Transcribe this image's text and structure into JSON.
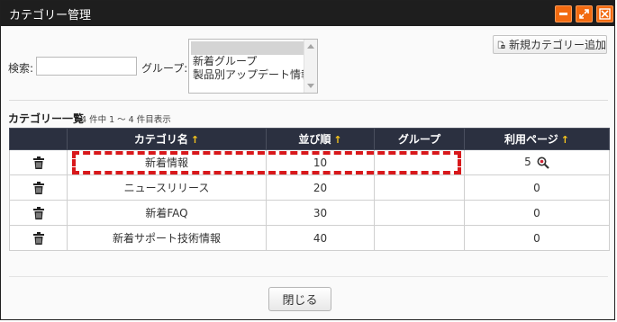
{
  "window": {
    "title": "カテゴリー管理"
  },
  "search": {
    "label": "検索:",
    "value": "",
    "placeholder": ""
  },
  "group_filter": {
    "label": "グループ:",
    "options": [
      "",
      "新着グループ",
      "製品別アップデート情報"
    ],
    "selected_index": 0
  },
  "toolbar": {
    "add_category_label": "新規カテゴリー追加"
  },
  "list": {
    "title": "カテゴリー一覧",
    "count_text": "4 件中 1 ～ 4 件目表示",
    "columns": {
      "name": "カテゴリ名",
      "order": "並び順",
      "group": "グループ",
      "usage": "利用ページ"
    },
    "sort_arrow": "↑",
    "rows": [
      {
        "name": "新着情報",
        "order": "10",
        "group": "",
        "usage": "5"
      },
      {
        "name": "ニュースリリース",
        "order": "20",
        "group": "",
        "usage": "0"
      },
      {
        "name": "新着FAQ",
        "order": "30",
        "group": "",
        "usage": "0"
      },
      {
        "name": "新着サポート技術情報",
        "order": "40",
        "group": "",
        "usage": "0"
      }
    ]
  },
  "footer": {
    "close_label": "閉じる"
  },
  "colors": {
    "titlebar": "#1e1e1e",
    "window_button": "#f26a10",
    "table_header": "#2b3040",
    "sort_arrow": "#f7c51e",
    "highlight": "#d8181b"
  }
}
